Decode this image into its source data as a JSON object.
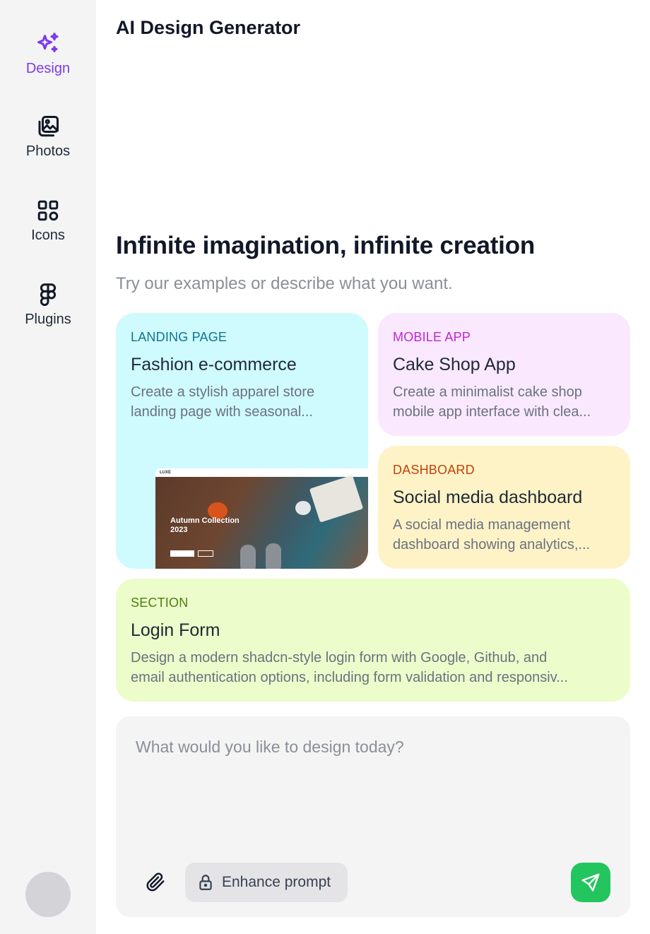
{
  "app": {
    "title": "AI Design Generator"
  },
  "sidebar": {
    "items": [
      {
        "label": "Design",
        "icon": "sparkles-icon",
        "active": true
      },
      {
        "label": "Photos",
        "icon": "photos-icon",
        "active": false
      },
      {
        "label": "Icons",
        "icon": "grid-icon",
        "active": false
      },
      {
        "label": "Plugins",
        "icon": "figma-icon",
        "active": false
      }
    ]
  },
  "hero": {
    "headline": "Infinite imagination, infinite creation",
    "subline": "Try our examples or describe what you want."
  },
  "examples": [
    {
      "category": "LANDING PAGE",
      "title": "Fashion e-commerce",
      "description_lines": [
        "Create a stylish apparel store",
        "landing page with seasonal..."
      ],
      "preview": {
        "heading": "Autumn Collection 2023",
        "nav_logo": "LUXE"
      }
    },
    {
      "category": "MOBILE APP",
      "title": "Cake Shop App",
      "description_lines": [
        "Create a minimalist cake shop",
        "mobile app interface with clea..."
      ]
    },
    {
      "category": "DASHBOARD",
      "title": "Social media dashboard",
      "description_lines": [
        "A social media management",
        "dashboard showing analytics,..."
      ]
    },
    {
      "category": "SECTION",
      "title": "Login Form",
      "description_lines": [
        "Design a modern shadcn-style login form with Google, Github, and",
        "email authentication options, including form validation and responsiv..."
      ]
    }
  ],
  "prompt": {
    "placeholder": "What would you like to design today?",
    "value": "",
    "enhance_label": "Enhance prompt"
  },
  "colors": {
    "accent": "#7c3aed",
    "send": "#22c55e",
    "landing_bg": "#cffafe",
    "mobile_bg": "#fae8ff",
    "dashboard_bg": "#fef3c7",
    "section_bg": "#ecfccb"
  }
}
